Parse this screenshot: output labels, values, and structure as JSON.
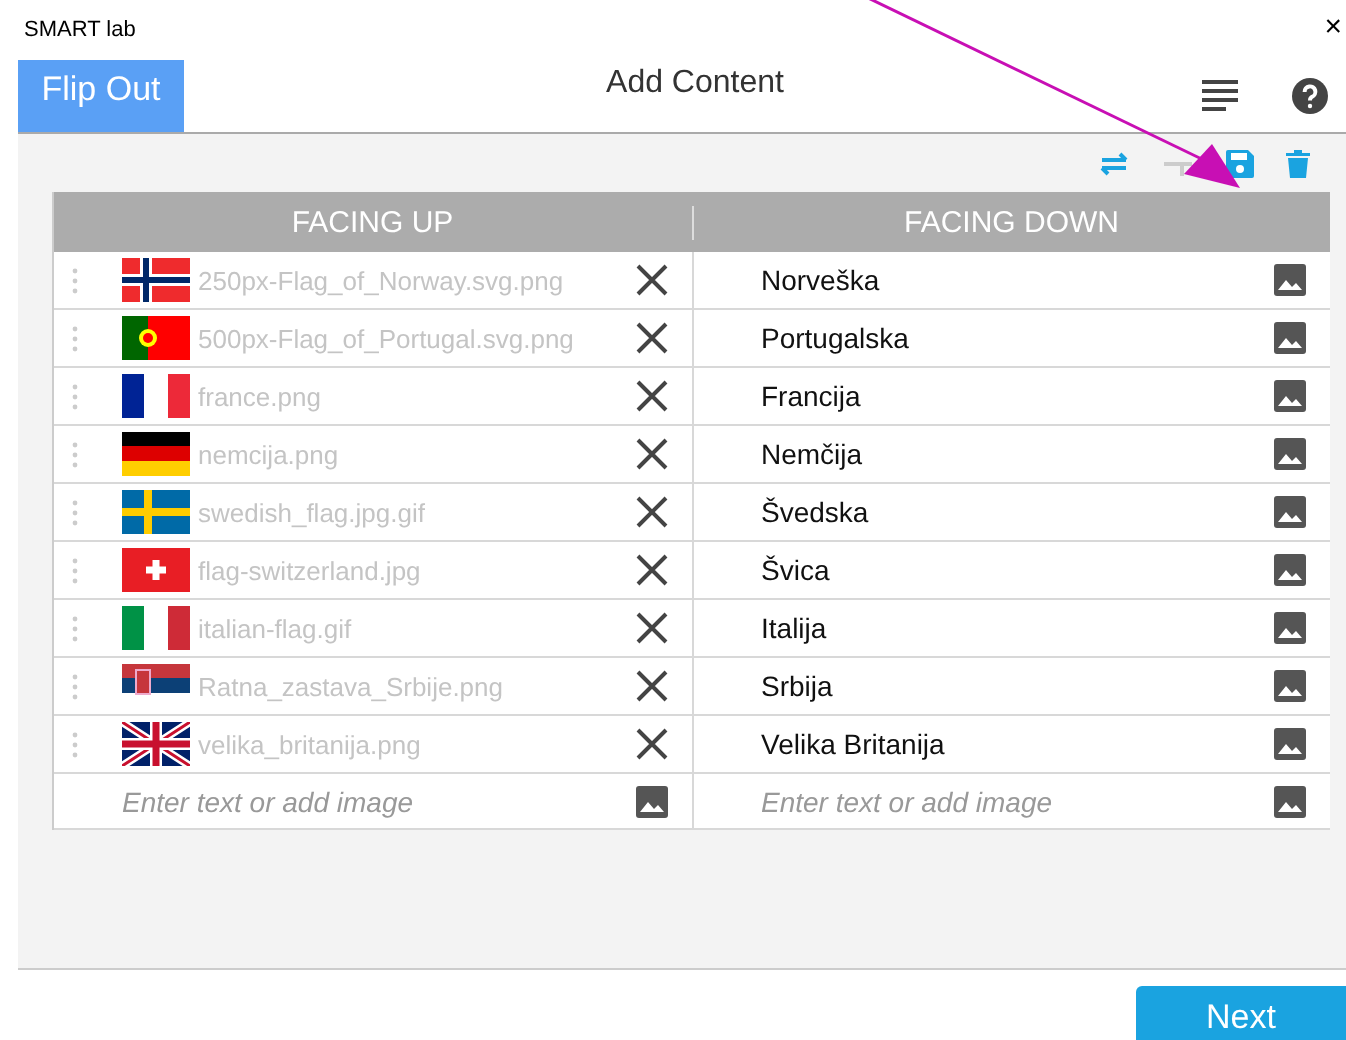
{
  "window": {
    "title": "SMART lab",
    "close": "×"
  },
  "header": {
    "tab": "Flip Out",
    "title": "Add Content"
  },
  "table": {
    "columns": [
      "FACING UP",
      "FACING DOWN"
    ],
    "rows": [
      {
        "kind": "norway",
        "file": "250px-Flag_of_Norway.svg.png",
        "back": "Norveška"
      },
      {
        "kind": "portugal",
        "file": "500px-Flag_of_Portugal.svg.png",
        "back": "Portugalska"
      },
      {
        "kind": "france",
        "file": "france.png",
        "back": "Francija"
      },
      {
        "kind": "germany",
        "file": "nemcija.png",
        "back": "Nemčija"
      },
      {
        "kind": "sweden",
        "file": "swedish_flag.jpg.gif",
        "back": "Švedska"
      },
      {
        "kind": "switzerland",
        "file": "flag-switzerland.jpg",
        "back": "Švica"
      },
      {
        "kind": "italy",
        "file": "italian-flag.gif",
        "back": "Italija"
      },
      {
        "kind": "serbia",
        "file": "Ratna_zastava_Srbije.png",
        "back": "Srbija"
      },
      {
        "kind": "uk",
        "file": "velika_britanija.png",
        "back": "Velika Britanija"
      }
    ],
    "new_row": {
      "front_placeholder": "Enter text or add image",
      "back_placeholder": "Enter text or add image"
    }
  },
  "footer": {
    "next": "Next"
  }
}
